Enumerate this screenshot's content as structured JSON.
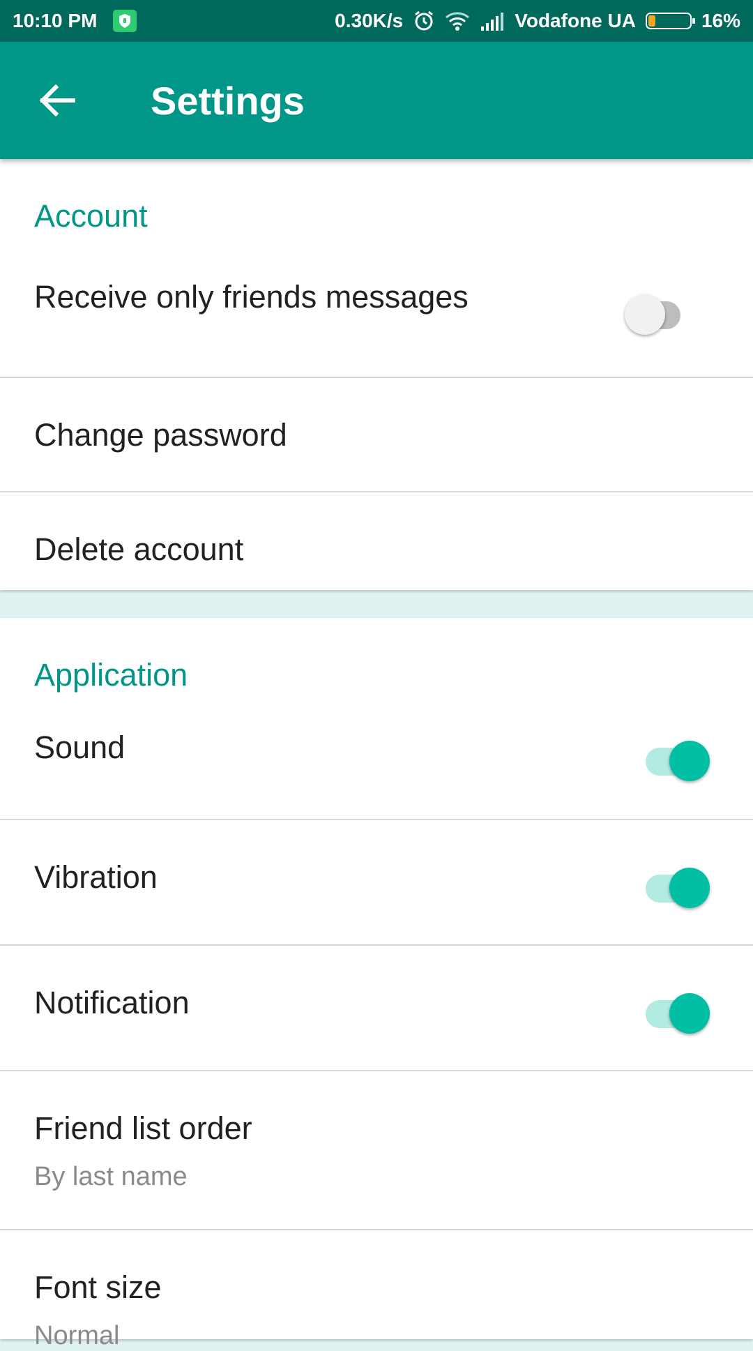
{
  "status_bar": {
    "time": "10:10 PM",
    "net_speed": "0.30K/s",
    "carrier": "Vodafone UA",
    "battery": "16%",
    "icons": [
      "shield-icon",
      "alarm-icon",
      "wifi-icon",
      "signal-icon",
      "battery-icon"
    ]
  },
  "app_bar": {
    "title": "Settings",
    "back_icon": "arrow-left-icon"
  },
  "account": {
    "header": "Account",
    "receive_friends": {
      "label": "Receive only friends messages",
      "on": false
    },
    "change_password": {
      "label": "Change password"
    },
    "delete_account": {
      "label": "Delete account"
    }
  },
  "application": {
    "header": "Application",
    "sound": {
      "label": "Sound",
      "on": true
    },
    "vibration": {
      "label": "Vibration",
      "on": true
    },
    "notification": {
      "label": "Notification",
      "on": true
    },
    "friend_list_order": {
      "label": "Friend list order",
      "value": "By last name"
    },
    "font_size": {
      "label": "Font size",
      "value": "Normal"
    }
  },
  "colors": {
    "status_bar": "#00695c",
    "app_bar": "#009688",
    "accent": "#00bfa5",
    "section_header": "#009688",
    "page_background": "#e0f2f1"
  }
}
